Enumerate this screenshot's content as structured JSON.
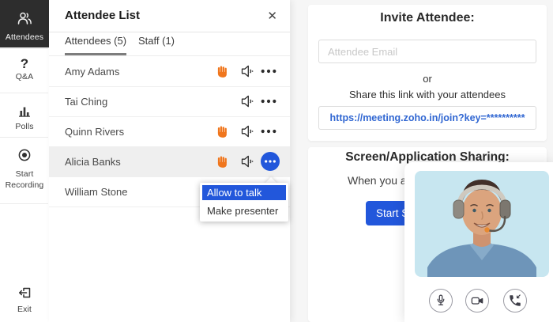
{
  "colors": {
    "accent_blue": "#2257DB",
    "link_blue": "#3167D2",
    "hand_orange": "#F0761D",
    "sidebar_active_bg": "#2D2D2D",
    "row_highlight": "#EFEFEF"
  },
  "sidebar": {
    "items": [
      {
        "label": "Attendees",
        "active": true
      },
      {
        "label": "Q&A",
        "active": false
      },
      {
        "label": "Polls",
        "active": false
      },
      {
        "label": "Start Recording",
        "active": false
      },
      {
        "label": "Exit",
        "active": false
      }
    ],
    "qa_icon_glyph": "?"
  },
  "attendee_panel": {
    "title": "Attendee List",
    "close_label": "✕",
    "tabs": [
      {
        "label": "Attendees (5)",
        "active": true
      },
      {
        "label": "Staff (1)",
        "active": false
      }
    ],
    "attendees": [
      {
        "name": "Amy Adams",
        "hand_raised": true,
        "audio_on": true,
        "selected": false
      },
      {
        "name": "Tai Ching",
        "hand_raised": false,
        "audio_on": true,
        "selected": false
      },
      {
        "name": "Quinn Rivers",
        "hand_raised": true,
        "audio_on": true,
        "selected": false
      },
      {
        "name": "Alicia Banks",
        "hand_raised": true,
        "audio_on": true,
        "selected": true
      },
      {
        "name": "William Stone",
        "hand_raised": false,
        "audio_on": false,
        "selected": false
      }
    ],
    "context_menu": {
      "items": [
        {
          "label": "Allow to talk",
          "highlighted": true
        },
        {
          "label": "Make presenter",
          "highlighted": false
        }
      ]
    }
  },
  "invite_section": {
    "heading": "Invite Attendee:",
    "email_placeholder": "Attendee Email",
    "or_label": "or",
    "share_label": "Share this link with your attendees",
    "share_link": "https://meeting.zoho.in/join?key=**********"
  },
  "sharing_section": {
    "heading": "Screen/Application Sharing:",
    "visible_text": "When you are",
    "button_visible_label": "Start Sh"
  },
  "video_overlay": {
    "controls": [
      {
        "icon": "microphone-icon"
      },
      {
        "icon": "camera-icon"
      },
      {
        "icon": "phone-icon"
      }
    ]
  }
}
